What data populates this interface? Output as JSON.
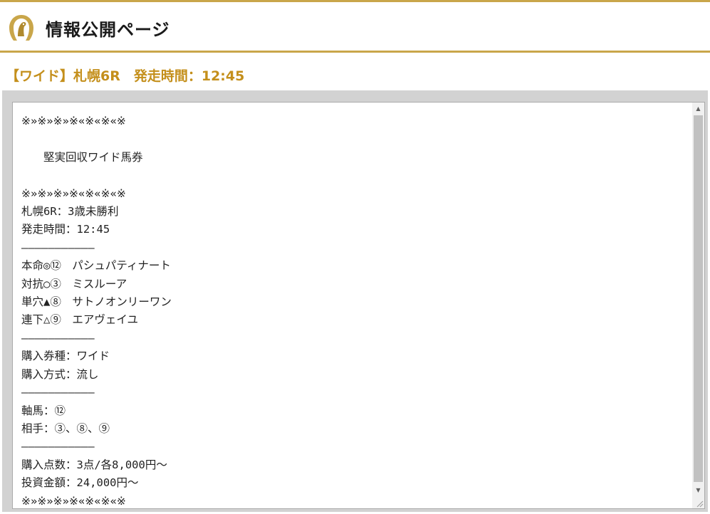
{
  "header": {
    "logo_icon": "horseshoe-horse-logo-icon",
    "title": "情報公開ページ",
    "accent_color": "#c9a64a"
  },
  "race_heading": "【ワイド】札幌6R　発走時間：12:45",
  "heading_color": "#c48f1b",
  "info_box": {
    "content": "※»※»※»※«※«※«※\n\n　　堅実回収ワイド馬券\n\n※»※»※»※«※«※«※\n札幌6R：3歳未勝利\n発走時間：12:45\n―――――――――――\n本命◎⑫　パシュパティナート\n対抗○③　ミスルーア\n単穴▲⑧　サトノオンリーワン\n連下△⑨　エアヴェイユ\n―――――――――――\n購入券種：ワイド\n購入方式：流し\n―――――――――――\n軸馬：⑫\n相手：③、⑧、⑨\n―――――――――――\n購入点数：3点/各8,000円～\n投資金額：24,000円～\n※»※»※»※«※«※«※"
  },
  "scrollbar": {
    "up_icon": "scroll-up-arrow-icon",
    "down_icon": "scroll-down-arrow-icon"
  }
}
